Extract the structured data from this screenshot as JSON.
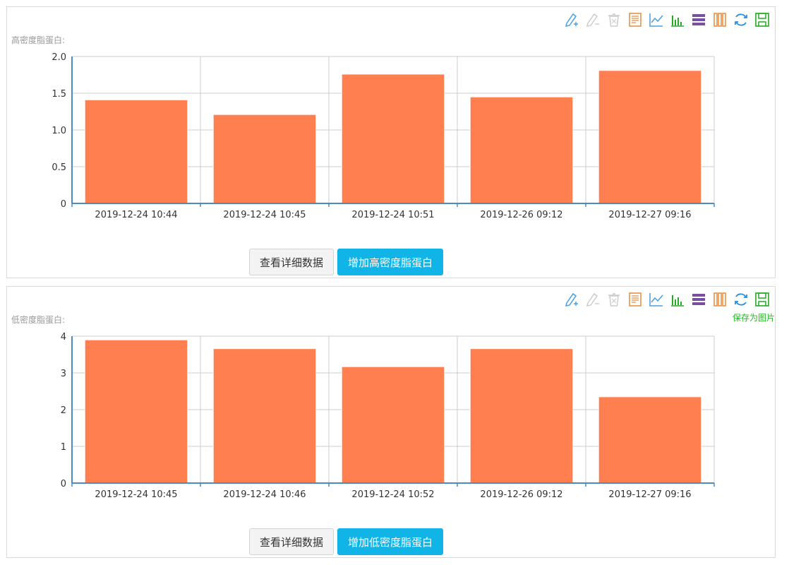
{
  "colors": {
    "bar": "#FF7F50",
    "axis": "#4b8bbe",
    "grid": "#cccccc",
    "tick_text": "#333333",
    "btn_primary": "#10b4e6"
  },
  "toolbox_icons": [
    "mark-icon",
    "mark-undo-icon",
    "mark-clear-icon",
    "data-view-icon",
    "line-chart-icon",
    "bar-chart-icon",
    "stack-icon",
    "tiled-icon",
    "restore-icon",
    "save-image-icon"
  ],
  "panels": [
    {
      "label": "高密度脂蛋白:",
      "tooltip": "",
      "buttons": {
        "view_details": "查看详细数据",
        "add": "增加高密度脂蛋白"
      }
    },
    {
      "label": "低密度脂蛋白:",
      "tooltip": "保存为图片",
      "buttons": {
        "view_details": "查看详细数据",
        "add": "增加低密度脂蛋白"
      }
    }
  ],
  "chart_data": [
    {
      "type": "bar",
      "title": "",
      "categories": [
        "2019-12-24 10:44",
        "2019-12-24 10:45",
        "2019-12-24 10:51",
        "2019-12-26 09:12",
        "2019-12-27 09:16"
      ],
      "values": [
        1.41,
        1.21,
        1.76,
        1.45,
        1.81
      ],
      "ylim": [
        0,
        2.0
      ],
      "yticks": [
        "0",
        "0.5",
        "1.0",
        "1.5",
        "2.0"
      ],
      "grid": true
    },
    {
      "type": "bar",
      "title": "",
      "categories": [
        "2019-12-24 10:45",
        "2019-12-24 10:46",
        "2019-12-24 10:52",
        "2019-12-26 09:12",
        "2019-12-27 09:16"
      ],
      "values": [
        3.9,
        3.66,
        3.17,
        3.66,
        2.35
      ],
      "ylim": [
        0,
        4
      ],
      "yticks": [
        "0",
        "1",
        "2",
        "3",
        "4"
      ],
      "grid": true
    }
  ]
}
